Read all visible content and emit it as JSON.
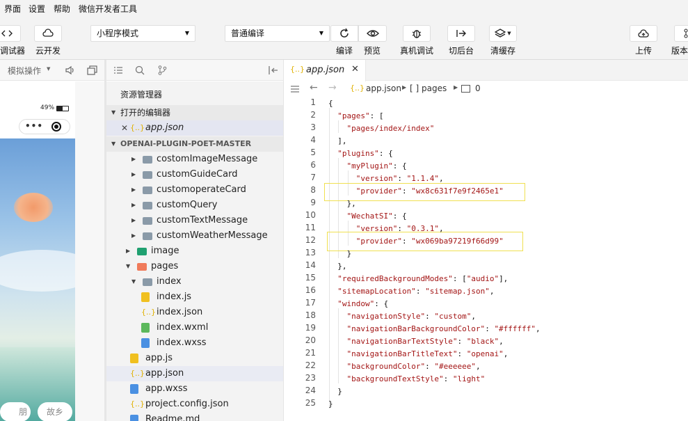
{
  "menubar": {
    "items": [
      "界面",
      "设置",
      "帮助",
      "微信开发者工具"
    ]
  },
  "toolbar": {
    "left_labels": [
      "调试器",
      "云开发"
    ],
    "mode_select": "小程序模式",
    "compile_select": "普通编译",
    "buttons": [
      {
        "label": "编译",
        "icon": "refresh-icon"
      },
      {
        "label": "预览",
        "icon": "eye-icon"
      },
      {
        "label": "真机调试",
        "icon": "bug-icon"
      },
      {
        "label": "切后台",
        "icon": "switch-icon"
      },
      {
        "label": "清缓存",
        "icon": "layers-icon"
      },
      {
        "label": "上传",
        "icon": "cloud-upload-icon"
      },
      {
        "label": "版本",
        "icon": "branch-icon"
      }
    ]
  },
  "simulator": {
    "toolbar_label": "模拟操作",
    "battery": "49%",
    "bottom_buttons": [
      "朋友",
      "故乡"
    ]
  },
  "explorer": {
    "title": "资源管理器",
    "open_editors_label": "打开的编辑器",
    "open_file": "app.json",
    "project_label": "OPENAI-PLUGIN-POET-MASTER",
    "tree": [
      {
        "label": "costomImageMessage",
        "type": "folder",
        "depth": 2
      },
      {
        "label": "customGuideCard",
        "type": "folder",
        "depth": 2
      },
      {
        "label": "customoperateCard",
        "type": "folder",
        "depth": 2
      },
      {
        "label": "customQuery",
        "type": "folder",
        "depth": 2
      },
      {
        "label": "customTextMessage",
        "type": "folder",
        "depth": 2
      },
      {
        "label": "customWeatherMessage",
        "type": "folder",
        "depth": 2
      },
      {
        "label": "image",
        "type": "folder-image",
        "depth": 1
      },
      {
        "label": "pages",
        "type": "folder-pages",
        "depth": 1,
        "open": true
      },
      {
        "label": "index",
        "type": "folder",
        "depth": 2,
        "open": true
      },
      {
        "label": "index.js",
        "type": "js",
        "depth": 3
      },
      {
        "label": "index.json",
        "type": "json",
        "depth": 3
      },
      {
        "label": "index.wxml",
        "type": "wxml",
        "depth": 3
      },
      {
        "label": "index.wxss",
        "type": "wxss",
        "depth": 3
      },
      {
        "label": "app.js",
        "type": "js",
        "depth": 1
      },
      {
        "label": "app.json",
        "type": "json",
        "depth": 1,
        "selected": true
      },
      {
        "label": "app.wxss",
        "type": "wxss",
        "depth": 1
      },
      {
        "label": "project.config.json",
        "type": "json",
        "depth": 1
      },
      {
        "label": "Readme.md",
        "type": "md",
        "depth": 1
      }
    ]
  },
  "editor": {
    "tab_label": "app.json",
    "tab_icon_text": "{..}",
    "breadcrumb": [
      "app.json",
      "[ ] pages",
      "0"
    ],
    "lines": [
      [
        [
          "p",
          "{"
        ]
      ],
      [
        [
          "p",
          "  "
        ],
        [
          "k",
          "\"pages\""
        ],
        [
          "p",
          ": ["
        ]
      ],
      [
        [
          "p",
          "    "
        ],
        [
          "s",
          "\"pages/index/index\""
        ]
      ],
      [
        [
          "p",
          "  ],"
        ]
      ],
      [
        [
          "p",
          "  "
        ],
        [
          "k",
          "\"plugins\""
        ],
        [
          "p",
          ": {"
        ]
      ],
      [
        [
          "p",
          "    "
        ],
        [
          "k",
          "\"myPlugin\""
        ],
        [
          "p",
          ": {"
        ]
      ],
      [
        [
          "p",
          "      "
        ],
        [
          "k",
          "\"version\""
        ],
        [
          "p",
          ": "
        ],
        [
          "s",
          "\"1.1.4\""
        ],
        [
          "p",
          ","
        ]
      ],
      [
        [
          "p",
          "      "
        ],
        [
          "k",
          "\"provider\""
        ],
        [
          "p",
          ": "
        ],
        [
          "s",
          "\"wx8c631f7e9f2465e1\""
        ]
      ],
      [
        [
          "p",
          "    },"
        ]
      ],
      [
        [
          "p",
          "    "
        ],
        [
          "k",
          "\"WechatSI\""
        ],
        [
          "p",
          ": {"
        ]
      ],
      [
        [
          "p",
          "      "
        ],
        [
          "k",
          "\"version\""
        ],
        [
          "p",
          ": "
        ],
        [
          "s",
          "\"0.3.1\""
        ],
        [
          "p",
          ","
        ]
      ],
      [
        [
          "p",
          "      "
        ],
        [
          "k",
          "\"provider\""
        ],
        [
          "p",
          ": "
        ],
        [
          "s",
          "\"wx069ba97219f66d99\""
        ]
      ],
      [
        [
          "p",
          "    }"
        ]
      ],
      [
        [
          "p",
          "  },"
        ]
      ],
      [
        [
          "p",
          "  "
        ],
        [
          "k",
          "\"requiredBackgroundModes\""
        ],
        [
          "p",
          ": ["
        ],
        [
          "s",
          "\"audio\""
        ],
        [
          "p",
          "],"
        ]
      ],
      [
        [
          "p",
          "  "
        ],
        [
          "k",
          "\"sitemapLocation\""
        ],
        [
          "p",
          ": "
        ],
        [
          "s",
          "\"sitemap.json\""
        ],
        [
          "p",
          ","
        ]
      ],
      [
        [
          "p",
          "  "
        ],
        [
          "k",
          "\"window\""
        ],
        [
          "p",
          ": {"
        ]
      ],
      [
        [
          "p",
          "    "
        ],
        [
          "k",
          "\"navigationStyle\""
        ],
        [
          "p",
          ": "
        ],
        [
          "s",
          "\"custom\""
        ],
        [
          "p",
          ","
        ]
      ],
      [
        [
          "p",
          "    "
        ],
        [
          "k",
          "\"navigationBarBackgroundColor\""
        ],
        [
          "p",
          ": "
        ],
        [
          "s",
          "\"#ffffff\""
        ],
        [
          "p",
          ","
        ]
      ],
      [
        [
          "p",
          "    "
        ],
        [
          "k",
          "\"navigationBarTextStyle\""
        ],
        [
          "p",
          ": "
        ],
        [
          "s",
          "\"black\""
        ],
        [
          "p",
          ","
        ]
      ],
      [
        [
          "p",
          "    "
        ],
        [
          "k",
          "\"navigationBarTitleText\""
        ],
        [
          "p",
          ": "
        ],
        [
          "s",
          "\"openai\""
        ],
        [
          "p",
          ","
        ]
      ],
      [
        [
          "p",
          "    "
        ],
        [
          "k",
          "\"backgroundColor\""
        ],
        [
          "p",
          ": "
        ],
        [
          "s",
          "\"#eeeeee\""
        ],
        [
          "p",
          ","
        ]
      ],
      [
        [
          "p",
          "    "
        ],
        [
          "k",
          "\"backgroundTextStyle\""
        ],
        [
          "p",
          ": "
        ],
        [
          "s",
          "\"light\""
        ]
      ],
      [
        [
          "p",
          "  }"
        ]
      ],
      [
        [
          "p",
          "}"
        ]
      ]
    ]
  },
  "colors": {
    "key": "#a31515",
    "string": "#a31515",
    "highlight_box": "#f0e050",
    "selected_row": "#e4e6f1"
  }
}
